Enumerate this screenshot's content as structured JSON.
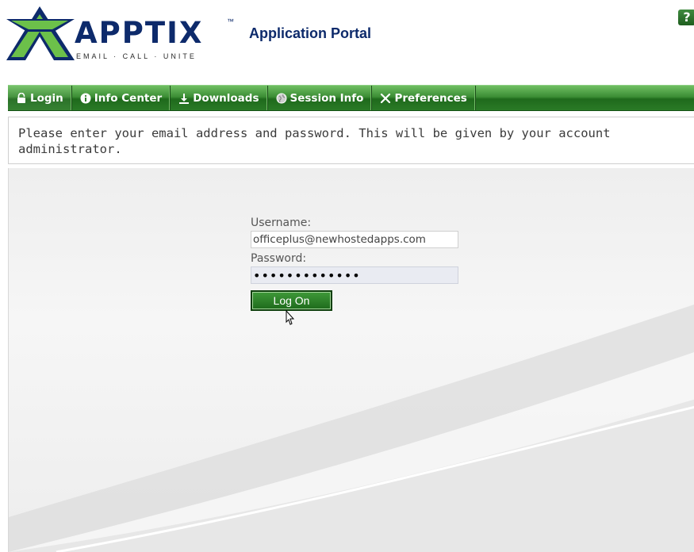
{
  "header": {
    "logo": {
      "wordmark": "APPTIX",
      "trademark": "™",
      "tagline": "EMAIL · CALL · UNITE"
    },
    "portal_title": "Application Portal",
    "help_icon": "help-icon",
    "help_symbol": "?"
  },
  "nav": {
    "items": [
      {
        "label": "Login",
        "icon": "lock-icon"
      },
      {
        "label": "Info Center",
        "icon": "info-icon"
      },
      {
        "label": "Downloads",
        "icon": "download-icon"
      },
      {
        "label": "Session Info",
        "icon": "globe-icon"
      },
      {
        "label": "Preferences",
        "icon": "tools-icon"
      }
    ]
  },
  "message": {
    "text": "Please enter your email address and password. This will be given by your account administrator."
  },
  "login": {
    "username_label": "Username:",
    "username_value": "officeplus@newhostedapps.com",
    "password_label": "Password:",
    "password_value": "•••••••••••••",
    "submit_label": "Log On"
  },
  "colors": {
    "nav_green": "#2f7d2a",
    "brand_navy": "#0d2a6b",
    "logo_green": "#6cc04a"
  }
}
